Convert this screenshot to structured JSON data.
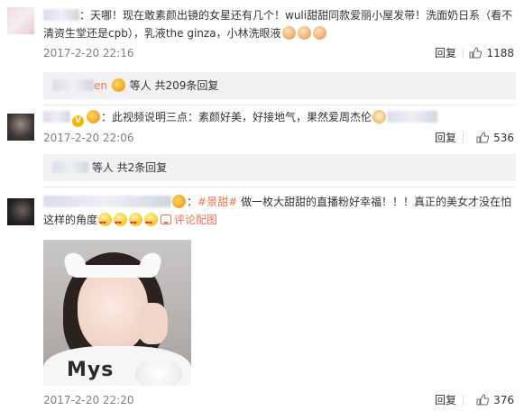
{
  "comments": [
    {
      "text_before": "：天哪！现在敢素颜出镜的女星还有几个！wuli甜甜同款爱丽小屋发带！洗面奶日系（看不清资生堂还是cpb），乳液the ginza，小林洗眼液",
      "time": "2017-2-20 22:16",
      "reply_label": "回复",
      "like_count": "1188",
      "emoji": [
        "peach-emoji",
        "peach-emoji",
        "peach-emoji"
      ]
    },
    {
      "username_suffix": "en",
      "text": "：此视频说明三点：素颜好美，好接地气，果然爱周杰伦",
      "time": "2017-2-20 22:06",
      "reply_label": "回复",
      "like_count": "536"
    },
    {
      "hashtag": "#景甜#",
      "text": " 做一枚大甜甜的直播粉好幸福！！！真正的美女才没在怕这样的角度",
      "image_comment_label": "评论配图",
      "time": "2017-2-20 22:20",
      "reply_label": "回复",
      "like_count": "376",
      "photo_shirt_text": "Mys"
    }
  ],
  "sub_replies": [
    {
      "label": "等人 共209条回复"
    },
    {
      "label": "等人 共2条回复"
    }
  ],
  "colors": {
    "accent": "#eb7350",
    "meta_gray": "#808080",
    "subbox_bg": "#f2f2f5"
  },
  "icons": {
    "like": "thumbs-up-icon",
    "badge": "vip-crown-icon",
    "verified": "verified-v-icon",
    "comment_image": "speech-bubble-icon"
  }
}
